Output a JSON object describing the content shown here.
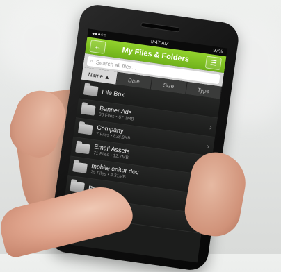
{
  "status": {
    "time": "9:47 AM",
    "battery": "97%"
  },
  "titlebar": {
    "title": "My Files & Folders",
    "back_icon": "back-arrow-icon",
    "menu_icon": "list-menu-icon"
  },
  "search": {
    "placeholder": "Search all files..."
  },
  "sort": {
    "tabs": [
      "Name ▲",
      "Date",
      "Size",
      "Type"
    ],
    "active": "Name ▲"
  },
  "list": [
    {
      "name": "File Box",
      "meta": ""
    },
    {
      "name": "Banner Ads",
      "meta": "80 Files • 67.1MB"
    },
    {
      "name": "Company",
      "meta": "7 Files • 828.9KB"
    },
    {
      "name": "Email Assets",
      "meta": "71 Files • 12.7MB"
    },
    {
      "name": "mobile editor doc",
      "meta": "25 Files • 4.31MB"
    },
    {
      "name": "Perso",
      "meta": ""
    },
    {
      "name": "",
      "meta": ""
    }
  ],
  "colors": {
    "accent": "#7fc322",
    "screen_bg": "#1c1d1c"
  }
}
